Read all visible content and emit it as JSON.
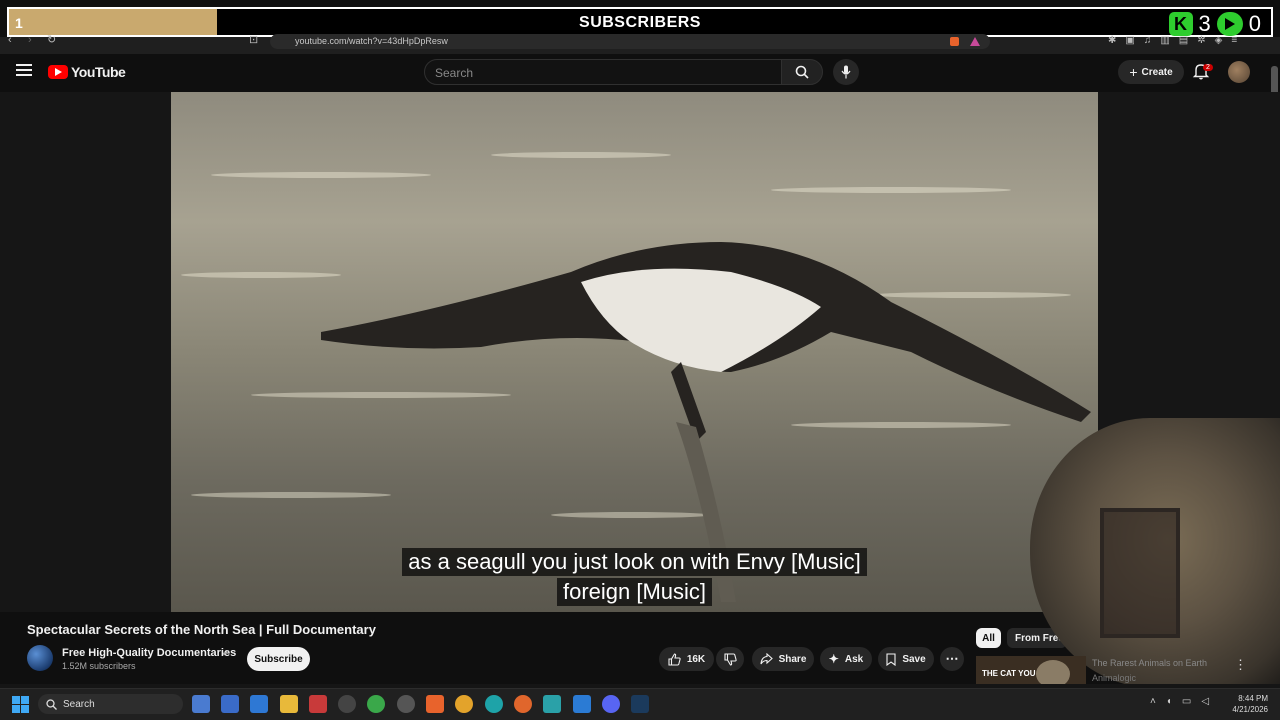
{
  "overlay": {
    "count": "1",
    "title": "SUBSCRIBERS",
    "badge_k": "K",
    "number_right": "3",
    "number_far": "0",
    "progress": 0.165
  },
  "browser": {
    "url": "youtube.com/watch?v=43dHpDpResw"
  },
  "header": {
    "logo": "YouTube",
    "search_placeholder": "Search",
    "create_label": "Create",
    "notification_count": "2"
  },
  "video": {
    "caption_line1": "as a seagull you just look on with Envy [Music]",
    "caption_line2": "foreign [Music]"
  },
  "meta": {
    "title": "Spectacular Secrets of the North Sea | Full Documentary",
    "channel_name": "Free High-Quality Documentaries",
    "channel_subs": "1.52M subscribers",
    "subscribe_label": "Subscribe",
    "likes": "16K",
    "share_label": "Share",
    "ask_label": "Ask",
    "save_label": "Save"
  },
  "recommendations": {
    "chip_all": "All",
    "chip_from": "From Free H",
    "thumb_text": "THE CAT YOU",
    "item_title": "The Rarest Animals on Earth",
    "item_channel": "Animalogic"
  },
  "taskbar": {
    "search_label": "Search",
    "time": "8:44 PM",
    "date": "4/21/2026"
  }
}
